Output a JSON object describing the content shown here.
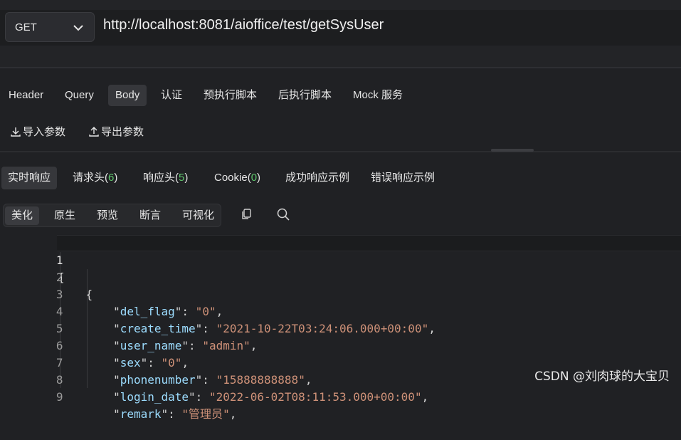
{
  "request": {
    "method": "GET",
    "url": "http://localhost:8081/aioffice/test/getSysUser"
  },
  "request_tabs": [
    "Header",
    "Query",
    "Body",
    "认证",
    "预执行脚本",
    "后执行脚本",
    "Mock 服务"
  ],
  "request_tab_active": "Body",
  "actions": {
    "import": "导入参数",
    "export": "导出参数"
  },
  "response_tabs": [
    {
      "label": "实时响应"
    },
    {
      "label": "请求头",
      "count": "6"
    },
    {
      "label": "响应头",
      "count": "5"
    },
    {
      "label": "Cookie",
      "count": "0"
    },
    {
      "label": "成功响应示例"
    },
    {
      "label": "错误响应示例"
    }
  ],
  "view_tabs": [
    "美化",
    "原生",
    "预览",
    "断言",
    "可视化"
  ],
  "view_tab_active": "美化",
  "code": {
    "line_numbers": [
      "1",
      "2",
      "3",
      "4",
      "5",
      "6",
      "7",
      "8",
      "9"
    ],
    "lines": [
      {
        "text": "["
      },
      {
        "text": "    {"
      },
      {
        "key": "del_flag",
        "value": "0"
      },
      {
        "key": "create_time",
        "value": "2021-10-22T03:24:06.000+00:00"
      },
      {
        "key": "user_name",
        "value": "admin"
      },
      {
        "key": "sex",
        "value": "0"
      },
      {
        "key": "phonenumber",
        "value": "15888888888"
      },
      {
        "key": "login_date",
        "value": "2022-06-02T08:11:53.000+00:00"
      },
      {
        "key": "remark",
        "value": "管理员"
      }
    ]
  },
  "watermark": "CSDN @刘肉球的大宝贝"
}
